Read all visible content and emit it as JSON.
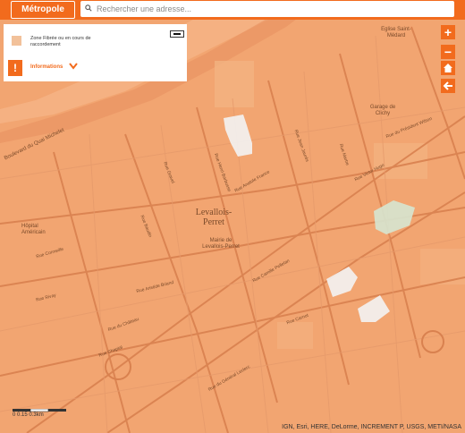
{
  "topbar": {
    "metropole_label": "Métropole",
    "search_placeholder": "Rechercher une adresse..."
  },
  "legend": {
    "zone_label": "Zone Fibrée ou en cours de raccordement",
    "info_label": "Informations",
    "info_mark": "!",
    "swatch_color": "#f2c19a"
  },
  "map_labels": {
    "city": "Levallois-Perret",
    "mairie": "Mairie de Levallois-Perret",
    "hopital": "Hôpital Américain",
    "eglise": "Eglise Saint-Médard",
    "garage": "Garage de Clichy",
    "quai": "Boulevard du Quai Michelet",
    "rue_anatole": "Rue Anatole France",
    "rue_gravel": "Rue Gravel",
    "rue_jean_jaures": "Rue Jean Jaurès",
    "rue_president": "Rue du Président Wilson",
    "rue_victor_hugo": "Rue Victor Hugo",
    "rue_aristide": "Rue Aristide Briand",
    "rue_camille": "Rue Camille Pelletan",
    "rue_chaptal": "Rue Chaptal",
    "rue_rivay": "Rue Rivay",
    "rue_martre": "Rue Martre",
    "rue_baudin": "Rue Baudin",
    "rue_henri": "Rue Henri Barbusse",
    "rue_carnot": "Rue Carnot",
    "rue_general": "Rue du Général Leclerc",
    "rue_cormeille": "Rue Cormeille",
    "rue_chateau": "Rue du Château"
  },
  "controls": {
    "zoom_in": "+",
    "zoom_out": "−",
    "home_icon": "home-icon",
    "back_icon": "arrow-left-icon"
  },
  "scale": {
    "text": "0     0.15     0.3km"
  },
  "attribution": "IGN, Esri, HERE, DeLorme, INCREMENT P, USGS, METI/NASA",
  "colors": {
    "accent": "#f26b1d",
    "fiber_zone": "#f2a571",
    "road": "#e0895a"
  }
}
